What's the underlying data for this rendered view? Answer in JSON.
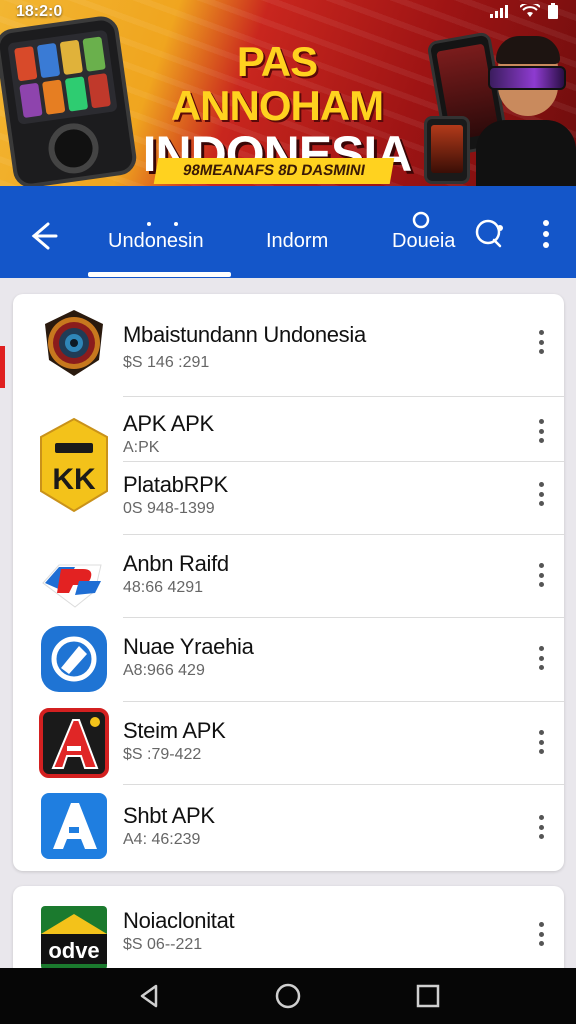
{
  "status": {
    "time": "18:2:0"
  },
  "banner": {
    "title_line1": "PAS ANNOHAM",
    "title_line2": "INDONESIA",
    "subtitle": "98MEANAFS 8D DASMINI"
  },
  "appbar": {
    "tabs": [
      {
        "label": "Undonesin",
        "active": true
      },
      {
        "label": "Indorm",
        "active": false
      },
      {
        "label": "Doueia",
        "active": false
      }
    ]
  },
  "apps": [
    {
      "name": "Mbaistundann Undonesia",
      "meta": "$S 146 :291",
      "icon": "roulette-wheel-icon"
    },
    {
      "name": "APK APK",
      "meta": "A:PK",
      "icon": "yellow-kk-badge-icon"
    },
    {
      "name": "PlatabRPK",
      "meta": "0S 948-1399",
      "icon": "none"
    },
    {
      "name": "Anbn Raifd",
      "meta": "48:66 4291",
      "icon": "red-blue-rp-logo-icon"
    },
    {
      "name": "Nuae Yraehia",
      "meta": "A8:966 429",
      "icon": "blue-circle-logo-icon"
    },
    {
      "name": "Steim APK",
      "meta": "$S :79-422",
      "icon": "red-a-logo-icon"
    },
    {
      "name": "Shbt APK",
      "meta": "A4: 46:239",
      "icon": "blue-a-logo-icon"
    },
    {
      "name": "Noiaclonitat",
      "meta": "$S 06--221",
      "icon": "odve-logo-icon"
    }
  ],
  "colors": {
    "appbar": "#1456c9",
    "background": "#e9e7ec",
    "navbar": "#060606"
  }
}
